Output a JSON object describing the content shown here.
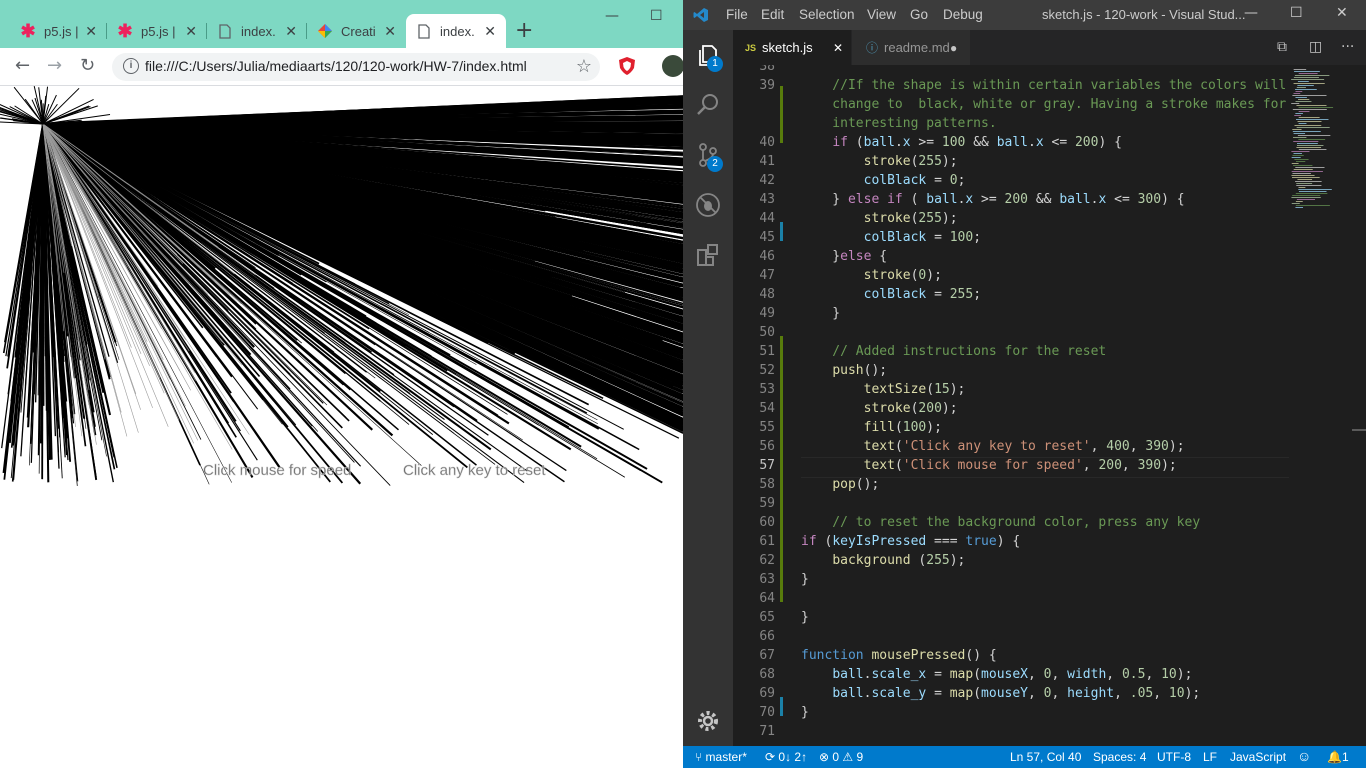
{
  "browser": {
    "tabs": [
      {
        "label": "p5.js |",
        "favicon": "p5-asterisk-icon",
        "active": false
      },
      {
        "label": "p5.js |",
        "favicon": "p5-asterisk-icon",
        "active": false
      },
      {
        "label": "index.",
        "favicon": "document-icon",
        "active": false
      },
      {
        "label": "Creati",
        "favicon": "color-diamond-icon",
        "active": false
      },
      {
        "label": "index.",
        "favicon": "document-icon",
        "active": true
      }
    ],
    "new_tab": "+",
    "window_controls": {
      "minimize": "—",
      "maximize": "☐"
    },
    "url": "file:///C:/Users/Julia/mediaarts/120/120-work/HW-7/index.html",
    "sketch_texts": {
      "speed": "Click mouse for speed",
      "reset": "Click any key to reset"
    }
  },
  "vscode": {
    "menu": [
      "File",
      "Edit",
      "Selection",
      "View",
      "Go",
      "Debug"
    ],
    "title": "sketch.js - 120-work - Visual Stud...",
    "window_controls": {
      "minimize": "—",
      "maximize": "☐",
      "close": "✕"
    },
    "activity_badges": {
      "explorer": "1",
      "scm": "2"
    },
    "tabs": [
      {
        "prefix": "JS",
        "label": "sketch.js",
        "suffix": "✕",
        "active": true
      },
      {
        "prefix": "ⓘ",
        "label": "readme.md",
        "suffix": "●",
        "active": false
      }
    ],
    "current_line": "57",
    "lines": [
      {
        "n": "38",
        "segs": []
      },
      {
        "n": "39",
        "segs": [
          {
            "t": "    //If the shape is within certain variables the colors will",
            "c": "c-com"
          }
        ]
      },
      {
        "n": "",
        "segs": [
          {
            "t": "    change to  black, white or gray. Having a stroke makes for",
            "c": "c-com"
          }
        ]
      },
      {
        "n": "",
        "segs": [
          {
            "t": "    interesting patterns.",
            "c": "c-com"
          }
        ]
      },
      {
        "n": "40",
        "segs": [
          {
            "t": "    "
          },
          {
            "t": "if",
            "c": "c-kw"
          },
          {
            "t": " ("
          },
          {
            "t": "ball",
            "c": "c-var"
          },
          {
            "t": "."
          },
          {
            "t": "x",
            "c": "c-var"
          },
          {
            "t": " >= "
          },
          {
            "t": "100",
            "c": "c-num"
          },
          {
            "t": " && "
          },
          {
            "t": "ball",
            "c": "c-var"
          },
          {
            "t": "."
          },
          {
            "t": "x",
            "c": "c-var"
          },
          {
            "t": " <= "
          },
          {
            "t": "200",
            "c": "c-num"
          },
          {
            "t": ") {"
          }
        ]
      },
      {
        "n": "41",
        "segs": [
          {
            "t": "        "
          },
          {
            "t": "stroke",
            "c": "c-fn"
          },
          {
            "t": "("
          },
          {
            "t": "255",
            "c": "c-num"
          },
          {
            "t": ");"
          }
        ]
      },
      {
        "n": "42",
        "segs": [
          {
            "t": "        "
          },
          {
            "t": "colBlack",
            "c": "c-var"
          },
          {
            "t": " = "
          },
          {
            "t": "0",
            "c": "c-num"
          },
          {
            "t": ";"
          }
        ]
      },
      {
        "n": "43",
        "segs": [
          {
            "t": "    } "
          },
          {
            "t": "else",
            "c": "c-kw"
          },
          {
            "t": " "
          },
          {
            "t": "if",
            "c": "c-kw"
          },
          {
            "t": " ( "
          },
          {
            "t": "ball",
            "c": "c-var"
          },
          {
            "t": "."
          },
          {
            "t": "x",
            "c": "c-var"
          },
          {
            "t": " >= "
          },
          {
            "t": "200",
            "c": "c-num"
          },
          {
            "t": " && "
          },
          {
            "t": "ball",
            "c": "c-var"
          },
          {
            "t": "."
          },
          {
            "t": "x",
            "c": "c-var"
          },
          {
            "t": " <= "
          },
          {
            "t": "300",
            "c": "c-num"
          },
          {
            "t": ") {"
          }
        ]
      },
      {
        "n": "44",
        "segs": [
          {
            "t": "        "
          },
          {
            "t": "stroke",
            "c": "c-fn"
          },
          {
            "t": "("
          },
          {
            "t": "255",
            "c": "c-num"
          },
          {
            "t": ");"
          }
        ]
      },
      {
        "n": "45",
        "segs": [
          {
            "t": "        "
          },
          {
            "t": "colBlack",
            "c": "c-var"
          },
          {
            "t": " = "
          },
          {
            "t": "100",
            "c": "c-num"
          },
          {
            "t": ";"
          }
        ]
      },
      {
        "n": "46",
        "segs": [
          {
            "t": "    }"
          },
          {
            "t": "else",
            "c": "c-kw"
          },
          {
            "t": " {"
          }
        ]
      },
      {
        "n": "47",
        "segs": [
          {
            "t": "        "
          },
          {
            "t": "stroke",
            "c": "c-fn"
          },
          {
            "t": "("
          },
          {
            "t": "0",
            "c": "c-num"
          },
          {
            "t": ");"
          }
        ]
      },
      {
        "n": "48",
        "segs": [
          {
            "t": "        "
          },
          {
            "t": "colBlack",
            "c": "c-var"
          },
          {
            "t": " = "
          },
          {
            "t": "255",
            "c": "c-num"
          },
          {
            "t": ";"
          }
        ]
      },
      {
        "n": "49",
        "segs": [
          {
            "t": "    }"
          }
        ]
      },
      {
        "n": "50",
        "segs": []
      },
      {
        "n": "51",
        "segs": [
          {
            "t": "    // Added instructions for the reset",
            "c": "c-com"
          }
        ]
      },
      {
        "n": "52",
        "segs": [
          {
            "t": "    "
          },
          {
            "t": "push",
            "c": "c-fn"
          },
          {
            "t": "();"
          }
        ]
      },
      {
        "n": "53",
        "segs": [
          {
            "t": "        "
          },
          {
            "t": "textSize",
            "c": "c-fn"
          },
          {
            "t": "("
          },
          {
            "t": "15",
            "c": "c-num"
          },
          {
            "t": ");"
          }
        ]
      },
      {
        "n": "54",
        "segs": [
          {
            "t": "        "
          },
          {
            "t": "stroke",
            "c": "c-fn"
          },
          {
            "t": "("
          },
          {
            "t": "200",
            "c": "c-num"
          },
          {
            "t": ");"
          }
        ]
      },
      {
        "n": "55",
        "segs": [
          {
            "t": "        "
          },
          {
            "t": "fill",
            "c": "c-fn"
          },
          {
            "t": "("
          },
          {
            "t": "100",
            "c": "c-num"
          },
          {
            "t": ");"
          }
        ]
      },
      {
        "n": "56",
        "segs": [
          {
            "t": "        "
          },
          {
            "t": "text",
            "c": "c-fn"
          },
          {
            "t": "("
          },
          {
            "t": "'Click any key to reset'",
            "c": "c-str"
          },
          {
            "t": ", "
          },
          {
            "t": "400",
            "c": "c-num"
          },
          {
            "t": ", "
          },
          {
            "t": "390",
            "c": "c-num"
          },
          {
            "t": ");"
          }
        ]
      },
      {
        "n": "57",
        "segs": [
          {
            "t": "        "
          },
          {
            "t": "text",
            "c": "c-fn"
          },
          {
            "t": "("
          },
          {
            "t": "'Click mouse for speed'",
            "c": "c-str"
          },
          {
            "t": ", "
          },
          {
            "t": "200",
            "c": "c-num"
          },
          {
            "t": ", "
          },
          {
            "t": "390",
            "c": "c-num"
          },
          {
            "t": ");"
          }
        ]
      },
      {
        "n": "58",
        "segs": [
          {
            "t": "    "
          },
          {
            "t": "pop",
            "c": "c-fn"
          },
          {
            "t": "();"
          }
        ]
      },
      {
        "n": "59",
        "segs": []
      },
      {
        "n": "60",
        "segs": [
          {
            "t": "    // to reset the background color, press any key",
            "c": "c-com"
          }
        ]
      },
      {
        "n": "61",
        "segs": [
          {
            "t": "if",
            "c": "c-kw"
          },
          {
            "t": " ("
          },
          {
            "t": "keyIsPressed",
            "c": "c-var"
          },
          {
            "t": " === "
          },
          {
            "t": "true",
            "c": "c-kw2"
          },
          {
            "t": ") {"
          }
        ]
      },
      {
        "n": "62",
        "segs": [
          {
            "t": "    "
          },
          {
            "t": "background",
            "c": "c-fn"
          },
          {
            "t": " ("
          },
          {
            "t": "255",
            "c": "c-num"
          },
          {
            "t": ");"
          }
        ]
      },
      {
        "n": "63",
        "segs": [
          {
            "t": "}"
          }
        ]
      },
      {
        "n": "64",
        "segs": []
      },
      {
        "n": "65",
        "segs": [
          {
            "t": "}"
          }
        ]
      },
      {
        "n": "66",
        "segs": []
      },
      {
        "n": "67",
        "segs": [
          {
            "t": "function",
            "c": "c-kw2"
          },
          {
            "t": " "
          },
          {
            "t": "mousePressed",
            "c": "c-fn"
          },
          {
            "t": "() {"
          }
        ]
      },
      {
        "n": "68",
        "segs": [
          {
            "t": "    "
          },
          {
            "t": "ball",
            "c": "c-var"
          },
          {
            "t": "."
          },
          {
            "t": "scale_x",
            "c": "c-var"
          },
          {
            "t": " = "
          },
          {
            "t": "map",
            "c": "c-fn"
          },
          {
            "t": "("
          },
          {
            "t": "mouseX",
            "c": "c-var"
          },
          {
            "t": ", "
          },
          {
            "t": "0",
            "c": "c-num"
          },
          {
            "t": ", "
          },
          {
            "t": "width",
            "c": "c-var"
          },
          {
            "t": ", "
          },
          {
            "t": "0.5",
            "c": "c-num"
          },
          {
            "t": ", "
          },
          {
            "t": "10",
            "c": "c-num"
          },
          {
            "t": ");"
          }
        ]
      },
      {
        "n": "69",
        "segs": [
          {
            "t": "    "
          },
          {
            "t": "ball",
            "c": "c-var"
          },
          {
            "t": "."
          },
          {
            "t": "scale_y",
            "c": "c-var"
          },
          {
            "t": " = "
          },
          {
            "t": "map",
            "c": "c-fn"
          },
          {
            "t": "("
          },
          {
            "t": "mouseY",
            "c": "c-var"
          },
          {
            "t": ", "
          },
          {
            "t": "0",
            "c": "c-num"
          },
          {
            "t": ", "
          },
          {
            "t": "height",
            "c": "c-var"
          },
          {
            "t": ", "
          },
          {
            "t": ".05",
            "c": "c-num"
          },
          {
            "t": ", "
          },
          {
            "t": "10",
            "c": "c-num"
          },
          {
            "t": ");"
          }
        ]
      },
      {
        "n": "70",
        "segs": [
          {
            "t": "}"
          }
        ]
      },
      {
        "n": "71",
        "segs": []
      }
    ],
    "status": {
      "branch": "master*",
      "sync": "0↓ 2↑",
      "problems": "⊗ 0 ⚠ 9",
      "position": "Ln 57, Col 40",
      "spaces": "Spaces: 4",
      "encoding": "UTF-8",
      "eol": "LF",
      "language": "JavaScript",
      "smiley": "☺",
      "notifications": "1"
    }
  },
  "colors": {
    "chrome_tabbar": "#7ed8c3",
    "vscode_status": "#007acc",
    "vscode_bg": "#1e1e1e",
    "p5_pink": "#ed225d"
  }
}
